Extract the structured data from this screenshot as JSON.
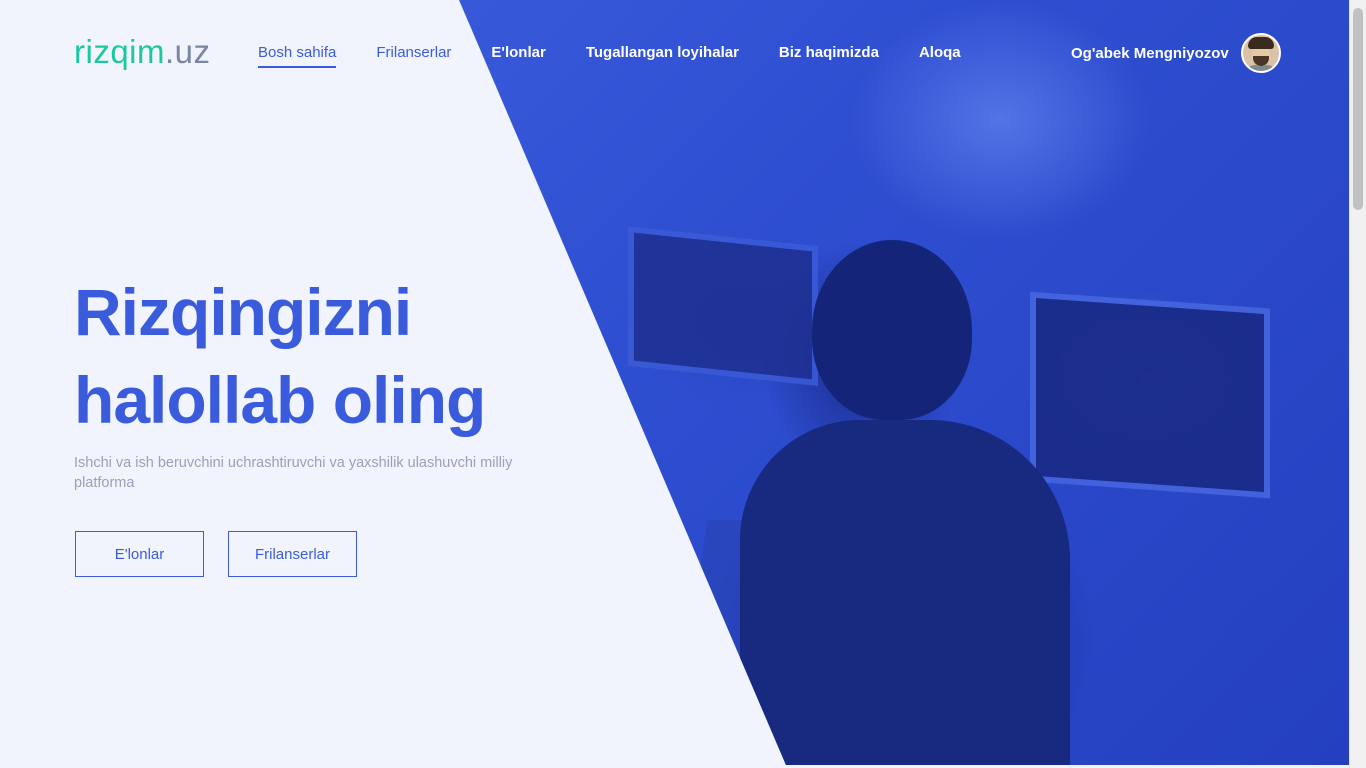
{
  "header": {
    "logo": {
      "part1": "rizqim",
      "part2": ".uz"
    },
    "nav": [
      {
        "label": "Bosh sahifa"
      },
      {
        "label": "Frilanserlar"
      },
      {
        "label": "E'lonlar"
      },
      {
        "label": "Tugallangan loyihalar"
      },
      {
        "label": "Biz haqimizda"
      },
      {
        "label": "Aloqa"
      }
    ],
    "user": {
      "name": "Og'abek Mengniyozov"
    }
  },
  "hero": {
    "title_line1": "Rizqingizni",
    "title_line2": "halollab oling",
    "subtitle": "Ishchi va ish beruvchini uchrashtiruvchi va yaxshilik ulashuvchi milliy platforma",
    "buttons": [
      {
        "label": "E'lonlar"
      },
      {
        "label": "Frilanserlar"
      }
    ]
  },
  "colors": {
    "primary": "#3a5cdc",
    "logo_accent": "#1cc8a0",
    "logo_muted": "#7a86a6",
    "background": "#f2f4fd"
  }
}
